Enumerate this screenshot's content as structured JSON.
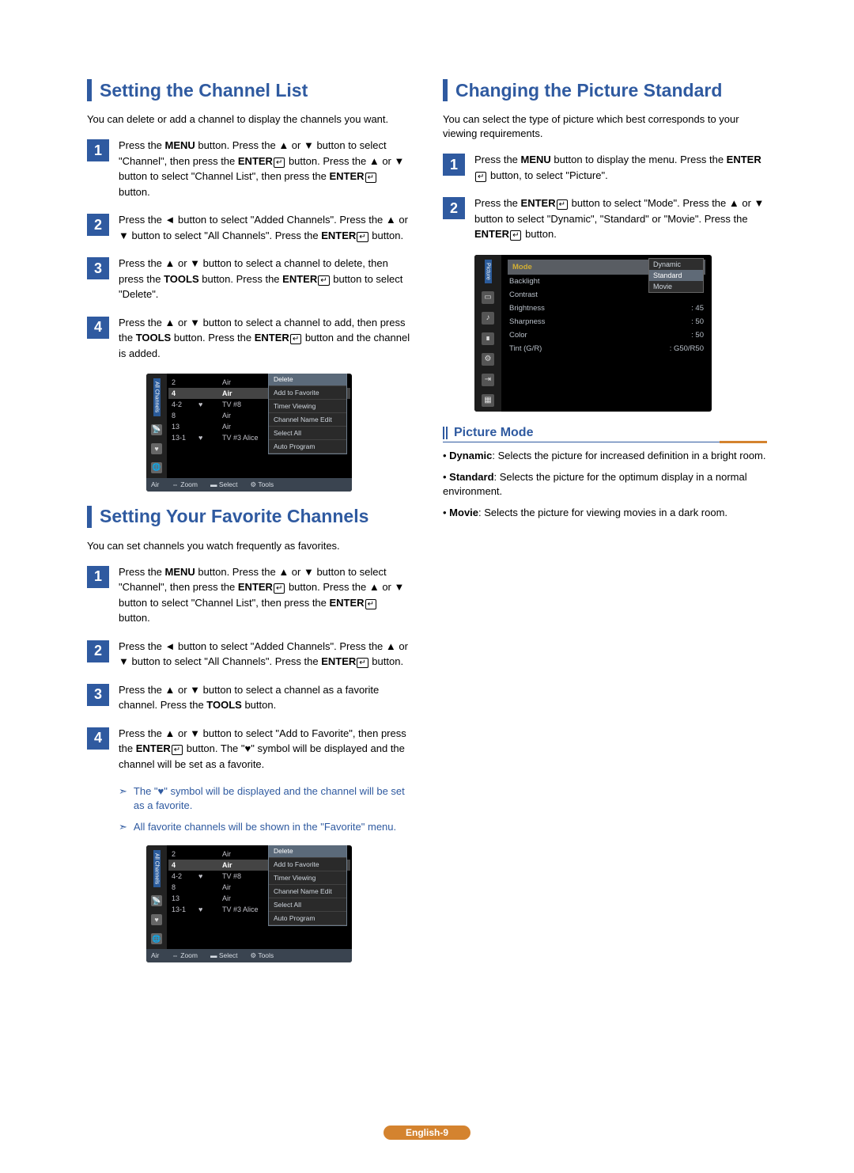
{
  "left": {
    "section1": {
      "title": "Setting the Channel List",
      "intro": "You can delete or add a channel to display the channels you want.",
      "steps": {
        "s1_a": "Press the ",
        "s1_b": "MENU",
        "s1_c": " button. Press the ▲ or ▼ button to select \"Channel\", then press the ",
        "s1_d": "ENTER",
        "s1_e": " button. Press the ▲ or ▼ button to select \"Channel List\", then press the ",
        "s1_f": "ENTER",
        "s1_g": " button.",
        "s2_a": "Press the ◄ button to select \"Added Channels\". Press the ▲ or ▼ button to select \"All Channels\". Press the ",
        "s2_b": "ENTER",
        "s2_c": " button.",
        "s3_a": "Press the ▲ or ▼ button to select a channel to delete, then press the ",
        "s3_b": "TOOLS",
        "s3_c": " button. Press the ",
        "s3_d": "ENTER",
        "s3_e": " button to select \"Delete\".",
        "s4_a": "Press the ▲ or ▼ button to select a channel to add, then press the ",
        "s4_b": "TOOLS",
        "s4_c": " button. Press the ",
        "s4_d": "ENTER",
        "s4_e": " button and the channel is added."
      }
    },
    "section2": {
      "title": "Setting Your Favorite Channels",
      "intro": "You can set channels you watch frequently as favorites.",
      "steps": {
        "s1_a": "Press the ",
        "s1_b": "MENU",
        "s1_c": " button. Press the ▲ or ▼ button to select \"Channel\", then press the ",
        "s1_d": "ENTER",
        "s1_e": " button. Press the ▲ or ▼ button to select \"Channel List\", then press the ",
        "s1_f": "ENTER",
        "s1_g": " button.",
        "s2_a": "Press the ◄ button to select \"Added Channels\". Press the ▲ or ▼ button to select \"All Channels\". Press the ",
        "s2_b": "ENTER",
        "s2_c": " button.",
        "s3_a": "Press the ▲ or ▼ button to select a channel as a favorite channel. Press the ",
        "s3_b": "TOOLS",
        "s3_c": " button.",
        "s4_a": "Press the ▲ or ▼ button to select \"Add to Favorite\", then press the ",
        "s4_b": "ENTER",
        "s4_c": " button. The \"♥\" symbol will be displayed and the channel will be set as a favorite."
      },
      "notes": {
        "n1": "The \"♥\" symbol will be displayed and the channel will be set as a favorite.",
        "n2": "All favorite channels will be shown in the \"Favorite\" menu."
      }
    },
    "osd": {
      "tab": "All Channels",
      "rows": [
        {
          "n": "2",
          "ant": "",
          "nm": "Air"
        },
        {
          "n": "4",
          "ant": "",
          "nm": "Air",
          "sel": true
        },
        {
          "n": "4-2",
          "ant": "♥",
          "nm": "TV #8"
        },
        {
          "n": "8",
          "ant": "",
          "nm": "Air"
        },
        {
          "n": "13",
          "ant": "",
          "nm": "Air"
        },
        {
          "n": "13-1",
          "ant": "♥",
          "nm": "TV #3 Alice"
        }
      ],
      "popup": [
        "Delete",
        "Add to Favorite",
        "Timer Viewing",
        "Channel Name Edit",
        "Select All",
        "Auto Program"
      ],
      "footer": {
        "ant": "Air",
        "zoom": "Zoom",
        "select": "Select",
        "tools": "Tools"
      }
    }
  },
  "right": {
    "section1": {
      "title": "Changing the Picture Standard",
      "intro": "You can select the type of picture which best corresponds to your viewing requirements.",
      "steps": {
        "s1_a": "Press the ",
        "s1_b": "MENU",
        "s1_c": " button to display the menu. Press the ",
        "s1_d": "ENTER",
        "s1_e": " button, to select \"Picture\".",
        "s2_a": "Press the ",
        "s2_b": "ENTER",
        "s2_c": " button to select \"Mode\". Press the ▲ or ▼ button to select \"Dynamic\", \"Standard\" or \"Movie\". Press the ",
        "s2_d": "ENTER",
        "s2_e": " button."
      }
    },
    "osd_picture": {
      "tab": "Picture",
      "mode_label": "Mode",
      "dropdown": [
        "Dynamic",
        "Standard",
        "Movie"
      ],
      "rows": [
        {
          "k": "Backlight",
          "v": ""
        },
        {
          "k": "Contrast",
          "v": ""
        },
        {
          "k": "Brightness",
          "v": ": 45"
        },
        {
          "k": "Sharpness",
          "v": ": 50"
        },
        {
          "k": "Color",
          "v": ": 50"
        },
        {
          "k": "Tint (G/R)",
          "v": ": G50/R50"
        }
      ]
    },
    "sub": {
      "title": "Picture Mode",
      "b1a": "Dynamic",
      "b1b": ": Selects the picture for increased definition in a bright room.",
      "b2a": "Standard",
      "b2b": ": Selects the picture for the optimum display in a normal environment.",
      "b3a": "Movie",
      "b3b": ": Selects the picture for viewing movies in a dark room."
    }
  },
  "page_number": "English-9"
}
